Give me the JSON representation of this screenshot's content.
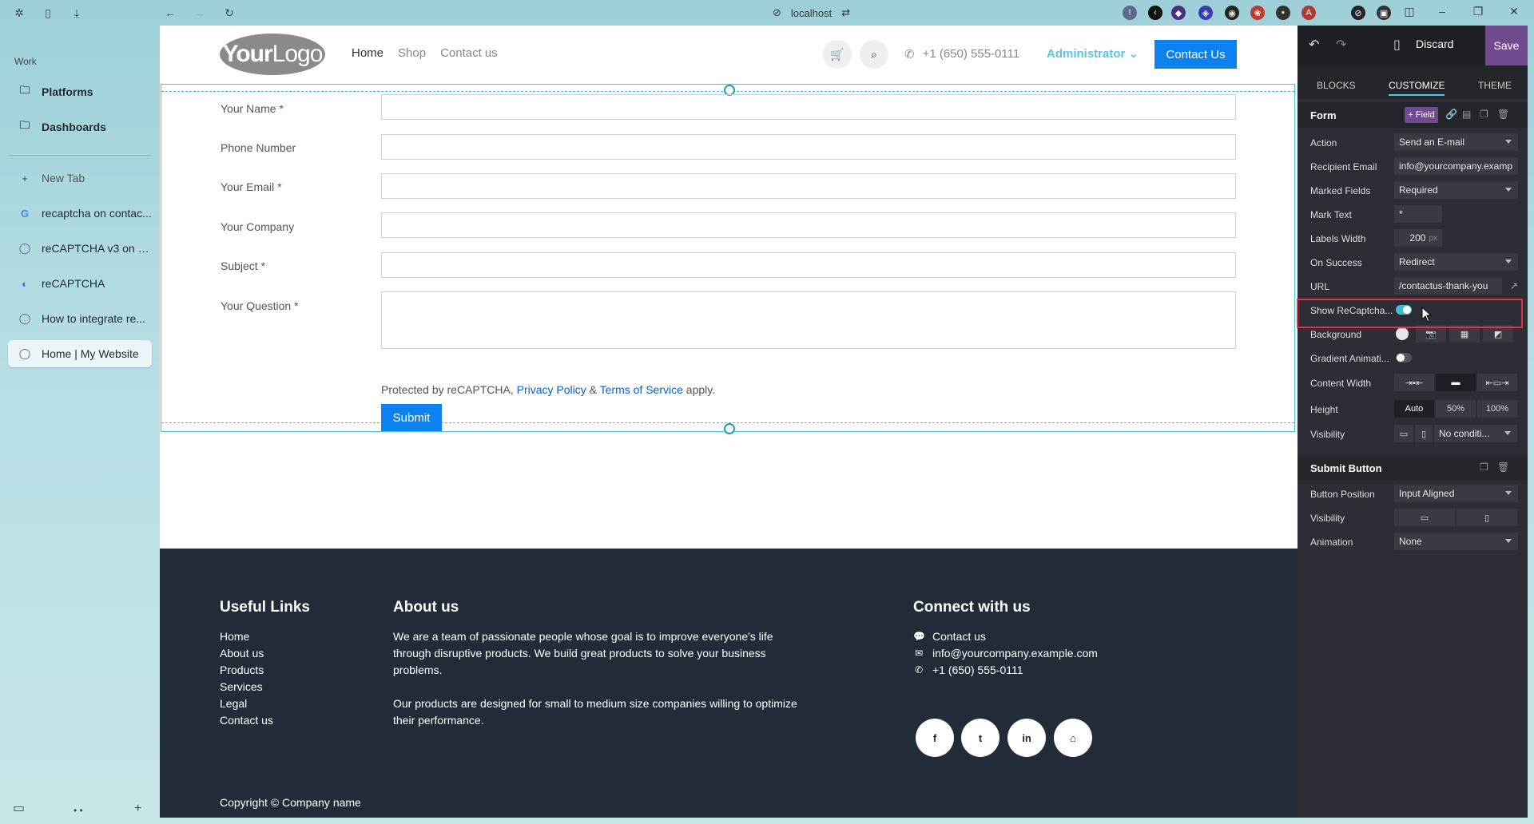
{
  "browser": {
    "url": "localhost",
    "icons": [
      "arc-logo-icon",
      "sidebar-toggle-icon",
      "download-icon",
      "back-icon",
      "forward-icon",
      "reload-icon",
      "link-icon",
      "site-settings-icon"
    ]
  },
  "sidebar": {
    "space_label": "Work",
    "folders": [
      {
        "label": "Platforms",
        "icon": "folder-icon"
      },
      {
        "label": "Dashboards",
        "icon": "folder-icon"
      }
    ],
    "new_tab": "New Tab",
    "tabs": [
      {
        "label": "recaptcha on contac...",
        "icon": "google-icon"
      },
      {
        "label": "reCAPTCHA v3 on fo...",
        "icon": "odoo-icon"
      },
      {
        "label": "reCAPTCHA",
        "icon": "recaptcha-icon"
      },
      {
        "label": "How to integrate re...",
        "icon": "odoo-icon"
      },
      {
        "label": "Home | My Website",
        "icon": "odoo-icon",
        "active": true
      }
    ]
  },
  "site": {
    "logo": {
      "bold": "Your",
      "light": "Logo"
    },
    "nav": [
      "Home",
      "Shop",
      "Contact us"
    ],
    "phone": "+1 (650) 555-0111",
    "admin": "Administrator",
    "cta": "Contact Us",
    "form": {
      "fields": [
        {
          "label": "Your Name *",
          "type": "input"
        },
        {
          "label": "Phone Number",
          "type": "input"
        },
        {
          "label": "Your Email *",
          "type": "input"
        },
        {
          "label": "Your Company",
          "type": "input"
        },
        {
          "label": "Subject *",
          "type": "input"
        },
        {
          "label": "Your Question *",
          "type": "textarea"
        }
      ],
      "recaptcha_prefix": "Protected by reCAPTCHA,",
      "privacy": "Privacy Policy",
      "amp": "&",
      "terms": "Terms of Service",
      "suffix": "apply.",
      "submit": "Submit"
    },
    "footer": {
      "useful_links_title": "Useful Links",
      "useful_links": [
        "Home",
        "About us",
        "Products",
        "Services",
        "Legal",
        "Contact us"
      ],
      "about_title": "About us",
      "about_p1": "We are a team of passionate people whose goal is to improve everyone's life through disruptive products. We build great products to solve your business problems.",
      "about_p2": "Our products are designed for small to medium size companies willing to optimize their performance.",
      "connect_title": "Connect with us",
      "contact": [
        "Contact us",
        "info@yourcompany.example.com",
        "+1 (650) 555-0111"
      ],
      "social": [
        "f",
        "t",
        "in",
        "⌂"
      ],
      "copyright": "Copyright © Company name"
    }
  },
  "editor": {
    "discard": "Discard",
    "save": "Save",
    "tabs": [
      "BLOCKS",
      "CUSTOMIZE",
      "THEME"
    ],
    "form_section": {
      "title": "Form",
      "add_field": "+ Field",
      "rows": [
        {
          "label": "Action",
          "value": "Send an E-mail"
        },
        {
          "label": "Recipient Email",
          "value": "info@yourcompany.examp"
        },
        {
          "label": "Marked Fields",
          "value": "Required"
        },
        {
          "label": "Mark Text",
          "value": "*"
        },
        {
          "label": "Labels Width",
          "value": "200",
          "unit": "px"
        },
        {
          "label": "On Success",
          "value": "Redirect"
        },
        {
          "label": "URL",
          "value": "/contactus-thank-you"
        },
        {
          "label": "Show ReCaptcha...",
          "toggle": true
        },
        {
          "label": "Background"
        },
        {
          "label": "Gradient Animati...",
          "toggle": false
        },
        {
          "label": "Content Width"
        },
        {
          "label": "Height",
          "options": [
            "Auto",
            "50%",
            "100%"
          ]
        },
        {
          "label": "Visibility",
          "value": "No conditi..."
        }
      ]
    },
    "submit_section": {
      "title": "Submit Button",
      "rows": [
        {
          "label": "Button Position",
          "value": "Input Aligned"
        },
        {
          "label": "Visibility"
        },
        {
          "label": "Animation",
          "value": "None"
        }
      ]
    },
    "accent": "#714b8e",
    "highlight_color": "#e0334a"
  }
}
